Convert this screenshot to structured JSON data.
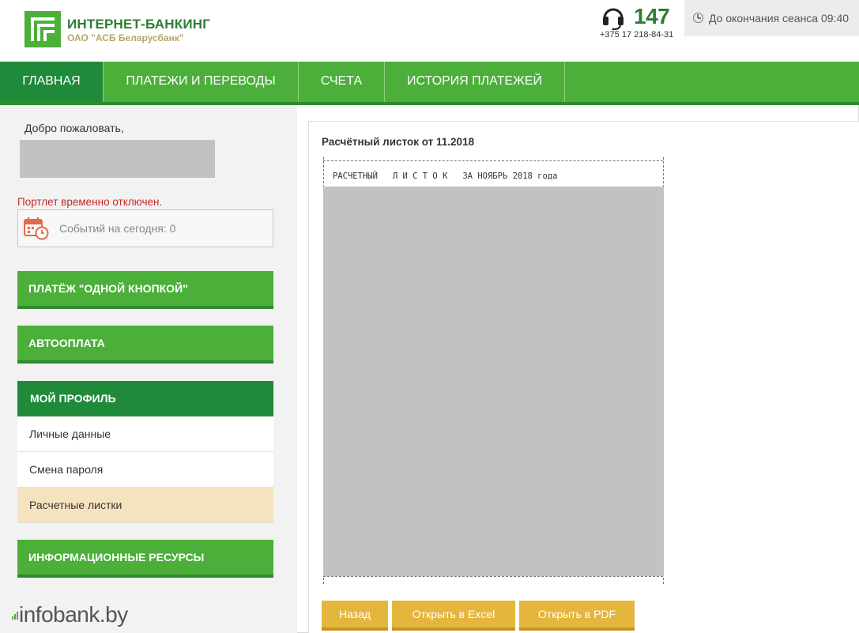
{
  "header": {
    "brand_title": "ИНТЕРНЕТ-БАНКИНГ",
    "brand_subtitle": "ОАО \"АСБ Беларусбанк\"",
    "support_number": "147",
    "support_phone": "+375 17 218-84-31",
    "session_text": "До окончания сеанса 09:40"
  },
  "nav": {
    "items": [
      {
        "label": "ГЛАВНАЯ",
        "active": true
      },
      {
        "label": "ПЛАТЕЖИ И ПЕРЕВОДЫ"
      },
      {
        "label": "СЧЕТА"
      },
      {
        "label": "ИСТОРИЯ ПЛАТЕЖЕЙ"
      }
    ]
  },
  "sidebar": {
    "welcome": "Добро пожаловать,",
    "portlet_notice": "Портлет временно отключен.",
    "events_text": "Событий на сегодня: 0",
    "one_click_payment": "ПЛАТЁЖ \"ОДНОЙ КНОПКОЙ\"",
    "autopay": "АВТООПЛАТА",
    "profile": {
      "title": "МОЙ ПРОФИЛЬ",
      "items": [
        "Личные данные",
        "Смена пароля",
        "Расчетные листки"
      ],
      "active_item": "Расчетные листки"
    },
    "info_resources": "ИНФОРМАЦИОННЫЕ РЕСУРСЫ"
  },
  "main": {
    "title": "Расчётный листок от 11.2018",
    "sheet_header": "РАСЧЕТНЫЙ   Л И С Т О К   ЗА НОЯБРЬ 2018 года",
    "buttons": {
      "back": "Назад",
      "excel": "Открыть в Excel",
      "pdf": "Открыть в PDF"
    }
  },
  "watermark": "infobank.by",
  "colors": {
    "brand_green": "#4caf3a",
    "dark_green": "#1e8a3a",
    "accent_orange": "#e4b63d",
    "active_item_bg": "#f5e3bf",
    "alert_red": "#c62828"
  }
}
